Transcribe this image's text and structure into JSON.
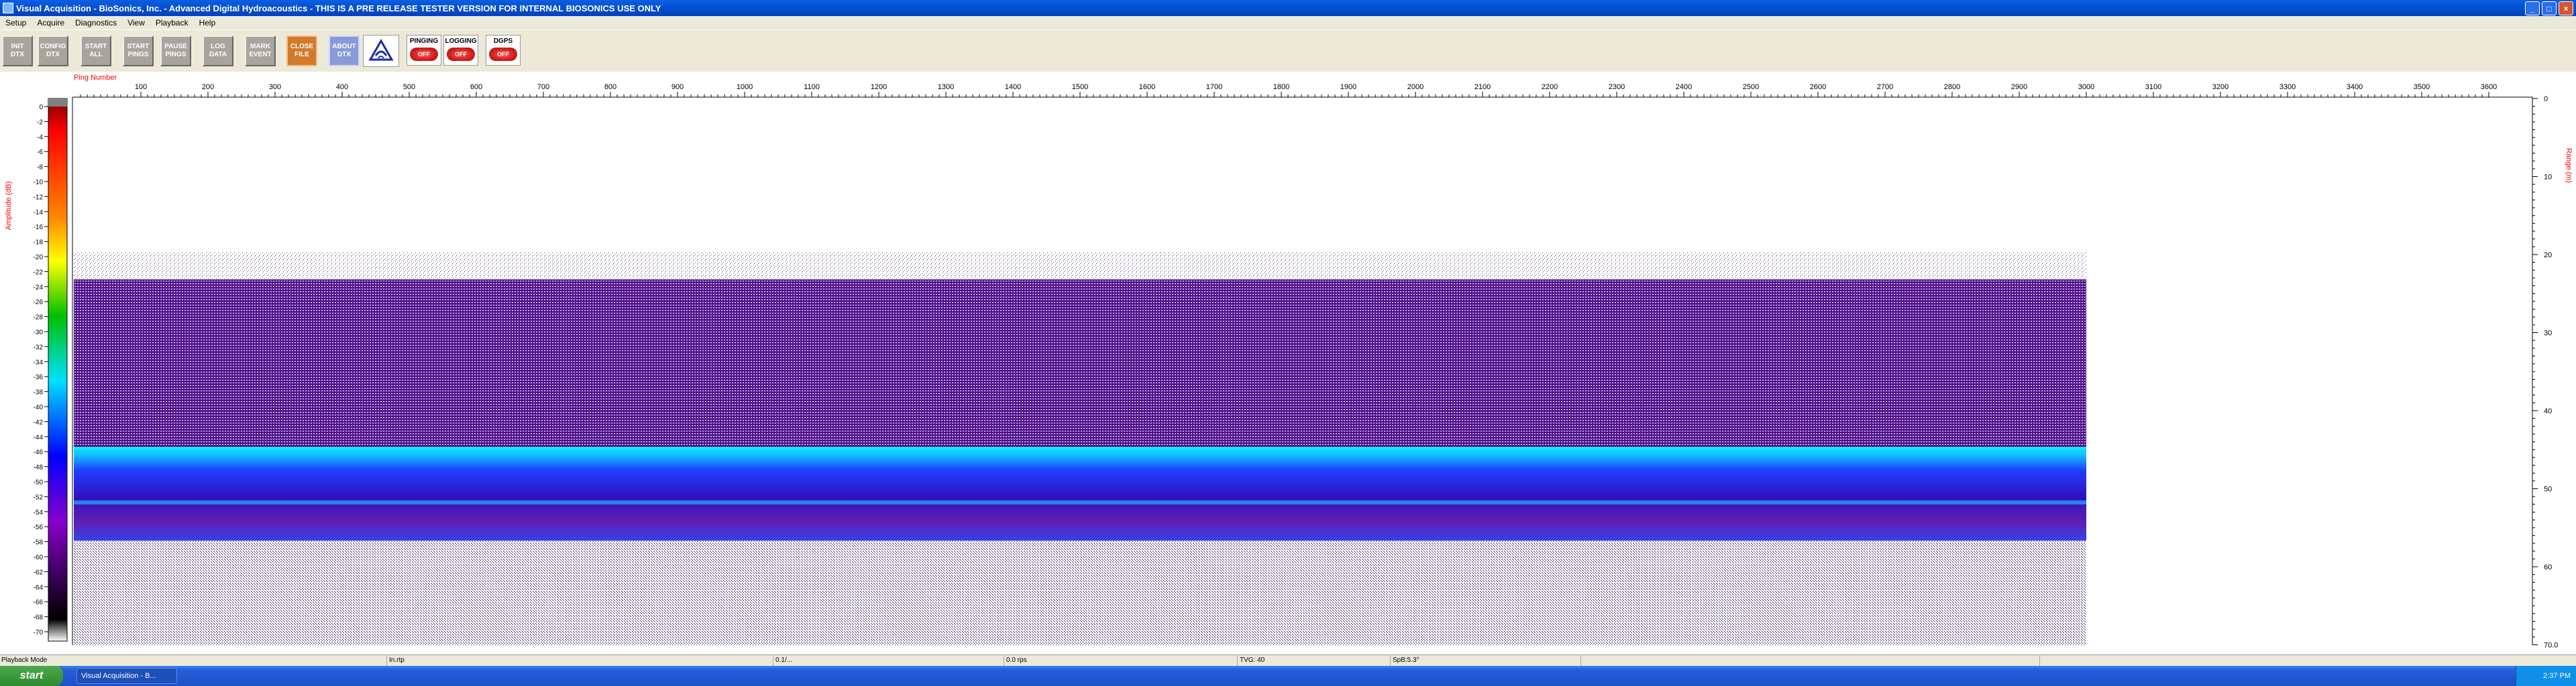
{
  "window": {
    "title": "Visual Acquisition  -  BioSonics, Inc.  -  Advanced Digital Hydroacoustics  -  THIS IS A PRE RELEASE TESTER VERSION FOR INTERNAL BIOSONICS USE ONLY",
    "minimize": "_",
    "maximize": "□",
    "close": "×"
  },
  "menu": [
    "Setup",
    "Acquire",
    "Diagnostics",
    "View",
    "Playback",
    "Help"
  ],
  "toolbar": {
    "buttons": [
      {
        "label": "INIT\nDTX",
        "style": "gray"
      },
      {
        "label": "CONFIG\nDTX",
        "style": "gray"
      },
      {
        "label": "START\nALL",
        "style": "gray"
      },
      {
        "label": "START\nPINGS",
        "style": "gray"
      },
      {
        "label": "PAUSE\nPINGS",
        "style": "gray"
      },
      {
        "label": "LOG\nDATA",
        "style": "gray"
      },
      {
        "label": "MARK\nEVENT",
        "style": "gray"
      },
      {
        "label": "CLOSE\nFILE",
        "style": "orange"
      },
      {
        "label": "ABOUT\nDTX",
        "style": "blue"
      }
    ],
    "indicators": [
      {
        "label": "PINGING",
        "state": "OFF"
      },
      {
        "label": "LOGGING",
        "state": "OFF"
      },
      {
        "label": "DGPS",
        "state": "OFF"
      }
    ]
  },
  "echogram": {
    "x_label": "Ping Number",
    "y_left_label": "Amplitude (dB)",
    "y_right_label": "Range (m)",
    "ping_ticks": [
      "100",
      "200",
      "300",
      "400",
      "500",
      "600",
      "700",
      "800",
      "900",
      "1000",
      "1100",
      "1200",
      "1300",
      "1400",
      "1500",
      "1600",
      "1700",
      "1800",
      "1900",
      "2000",
      "2100",
      "2200",
      "2300",
      "2400",
      "2500",
      "2600",
      "2700",
      "2800",
      "2900",
      "3000",
      "3100",
      "3200",
      "3300",
      "3400",
      "3500",
      "3600"
    ],
    "amp_ticks": [
      "0",
      "-2",
      "-4",
      "-6",
      "-8",
      "-10",
      "-12",
      "-14",
      "-16",
      "-18",
      "-20",
      "-22",
      "-24",
      "-26",
      "-28",
      "-30",
      "-32",
      "-34",
      "-36",
      "-38",
      "-40",
      "-42",
      "-44",
      "-46",
      "-48",
      "-50",
      "-52",
      "-54",
      "-56",
      "-58",
      "-60",
      "-62",
      "-64",
      "-66",
      "-68",
      "-70"
    ],
    "range_ticks": [
      "0",
      "10",
      "20",
      "30",
      "40",
      "50",
      "60",
      "70.0"
    ],
    "colors": {
      "deep": "#3a0b6e",
      "purple": "#6a2aa8",
      "blue": "#1030ff",
      "cyan": "#10c8ff",
      "green": "#20d060",
      "axis_label": "#ff0000"
    }
  },
  "status": [
    {
      "text": "Playback Mode"
    },
    {
      "text": "In.rtp"
    },
    {
      "text": "0.1/..."
    },
    {
      "text": "0.0 rps"
    },
    {
      "text": "TVG: 40"
    },
    {
      "text": "SpB:5.3°"
    }
  ],
  "taskbar": {
    "start": "start",
    "item": "Visual Acquisition - B...",
    "clock": "2:37 PM"
  }
}
